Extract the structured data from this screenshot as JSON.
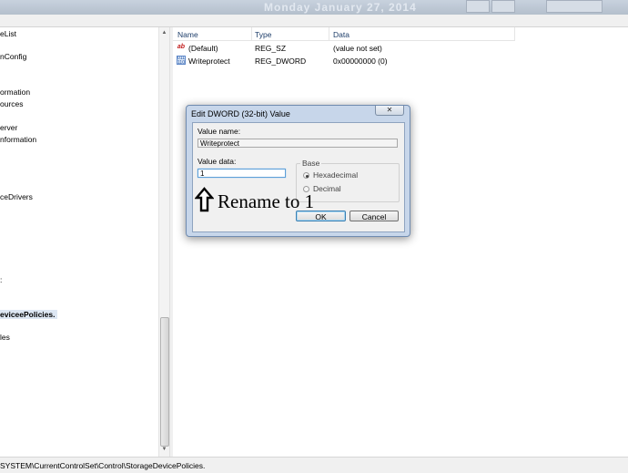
{
  "window": {
    "faded_date": "Monday   January 27, 2014"
  },
  "tree": {
    "items": [
      {
        "label": "eList"
      },
      {
        "label": "nConfig"
      },
      {
        "label": "ormation"
      },
      {
        "label": "ources"
      },
      {
        "label": "erver"
      },
      {
        "label": "nformation"
      },
      {
        "label": "ceDrivers"
      },
      {
        "label": ":"
      },
      {
        "label": "eviceePolicies."
      },
      {
        "label": "les"
      }
    ]
  },
  "list": {
    "columns": {
      "name": "Name",
      "type": "Type",
      "data": "Data"
    },
    "rows": [
      {
        "icon": "string-value-icon",
        "icon_glyph": "ab",
        "name": "(Default)",
        "type": "REG_SZ",
        "data": "(value not set)"
      },
      {
        "icon": "binary-value-icon",
        "icon_glyph": "011 110",
        "name": "Writeprotect",
        "type": "REG_DWORD",
        "data": "0x00000000 (0)"
      }
    ]
  },
  "statusbar": {
    "path": "SYSTEM\\CurrentControlSet\\Control\\StorageDevicePolicies."
  },
  "dialog": {
    "title": "Edit DWORD (32-bit) Value",
    "close_glyph": "✕",
    "value_name_label": "Value name:",
    "value_name": "Writeprotect",
    "value_data_label": "Value data:",
    "value_data": "1",
    "base": {
      "title": "Base",
      "options": [
        {
          "label": "Hexadecimal",
          "selected": true
        },
        {
          "label": "Decimal",
          "selected": false
        }
      ]
    },
    "ok_label": "OK",
    "cancel_label": "Cancel"
  },
  "annotation": {
    "text": "Rename to 1"
  }
}
